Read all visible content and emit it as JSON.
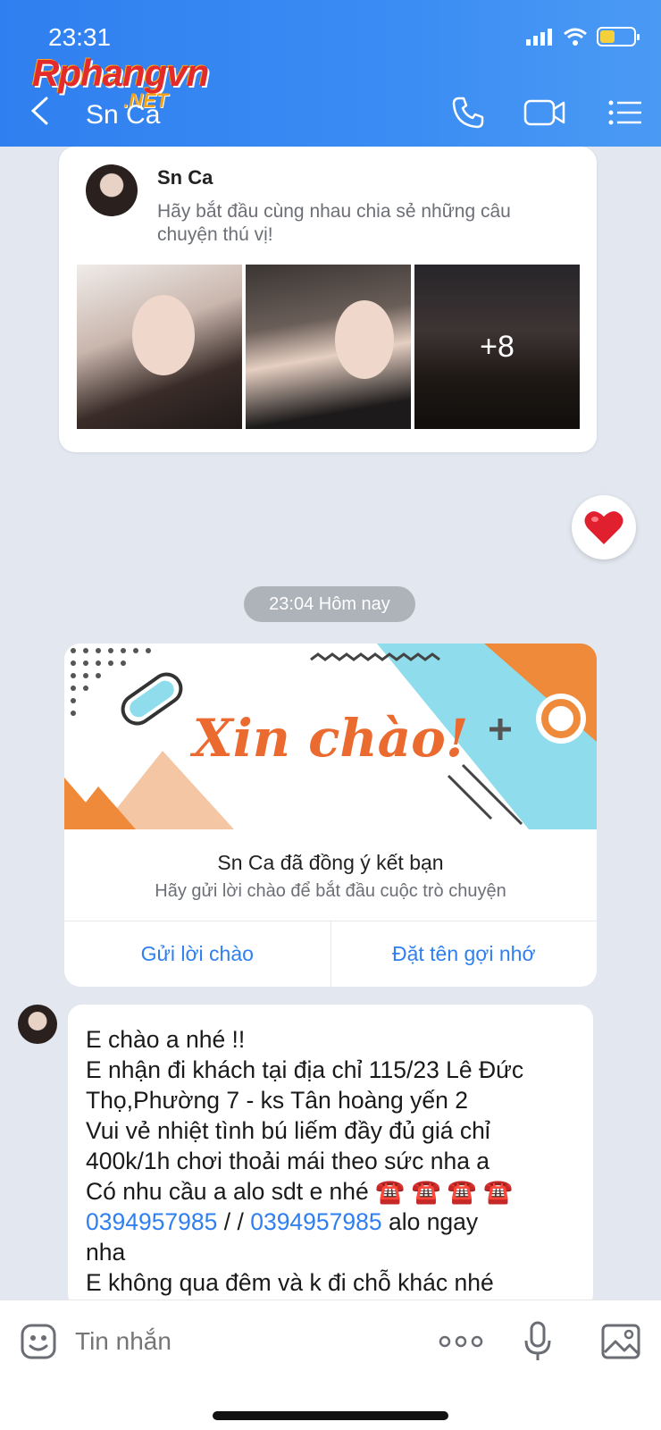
{
  "status_bar": {
    "time": "23:31",
    "battery_level": 0.45,
    "battery_color": "#f5d03a"
  },
  "watermark": {
    "main": "Rphangvn",
    "suffix": ".NET"
  },
  "header": {
    "title": "Sn Ca",
    "back_icon": "chevron-left-icon",
    "call_icon": "phone-icon",
    "video_icon": "video-camera-icon",
    "menu_icon": "list-menu-icon",
    "bg_color": "#2f7ff0"
  },
  "profile_card": {
    "name": "Sn Ca",
    "description": "Hãy bắt đầu cùng nhau chia sẻ những câu chuyện thú vị!",
    "more_photos": "+8"
  },
  "reaction": {
    "icon": "heart-icon",
    "color": "#e0202f"
  },
  "timestamp": "23:04 Hôm nay",
  "friend_card": {
    "banner_text": "Xin chào!",
    "title": "Sn Ca đã đồng ý kết bạn",
    "subtitle": "Hãy gửi lời chào để bắt đầu cuộc trò chuyện",
    "primary_action": "Gửi lời chào",
    "secondary_action": "Đặt tên gợi nhớ"
  },
  "message": {
    "line1": "E chào a nhé !!",
    "line2": "E nhận đi khách tại địa chỉ 115/23 Lê Đức",
    "line3": "Thọ,Phường 7 - ks Tân hoàng yến 2",
    "line4": "Vui vẻ nhiệt tình bú liếm đầy đủ giá chỉ",
    "line5": "400k/1h chơi thoải mái theo sức nha a",
    "line6": "Có nhu cầu a alo sdt e nhé ☎️ ☎️ ☎️ ☎️",
    "phone1": "0394957985",
    "separator": " / / ",
    "phone2": "0394957985",
    "phone_suffix": " alo ngay",
    "line8": "nha",
    "line9": "E không qua đêm và k đi chỗ khác nhé"
  },
  "composer": {
    "placeholder": "Tin nhắn",
    "emoji_icon": "emoji-smile-icon",
    "more_icon": "more-dots-icon",
    "mic_icon": "microphone-icon",
    "image_icon": "image-gallery-icon"
  }
}
